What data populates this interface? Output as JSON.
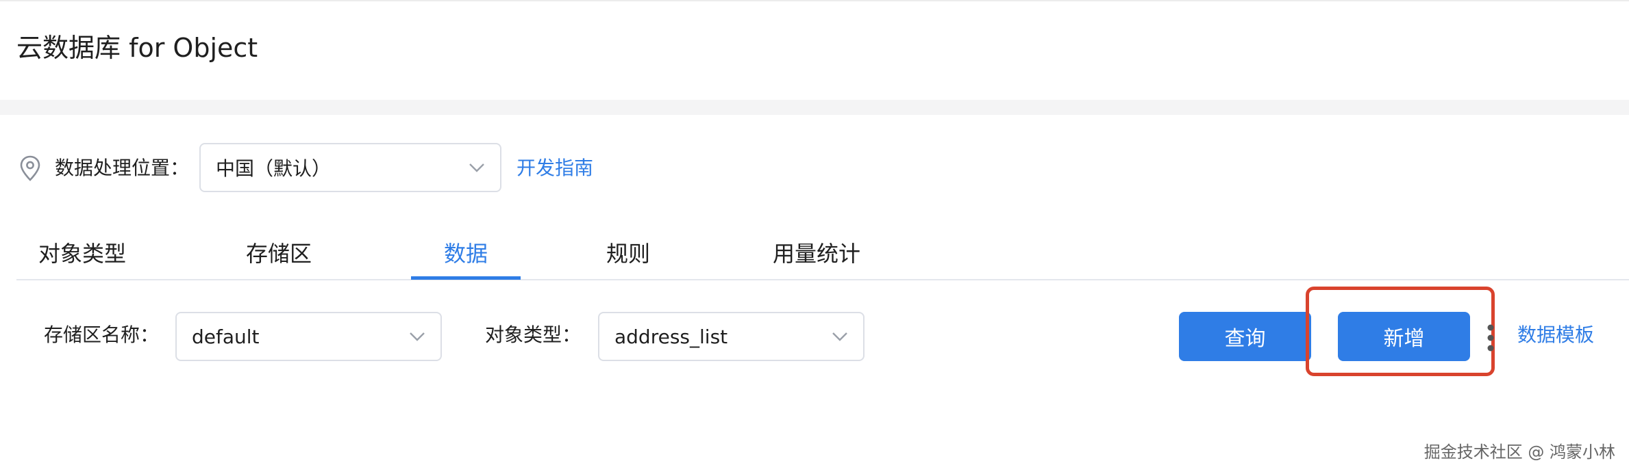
{
  "header": {
    "title": "云数据库 for Object"
  },
  "location": {
    "icon": "map-pin-icon",
    "label": "数据处理位置：",
    "selected": "中国（默认）",
    "guide_link": "开发指南"
  },
  "tabs": [
    {
      "label": "对象类型",
      "active": false
    },
    {
      "label": "存储区",
      "active": false
    },
    {
      "label": "数据",
      "active": true
    },
    {
      "label": "规则",
      "active": false
    },
    {
      "label": "用量统计",
      "active": false
    }
  ],
  "filters": {
    "bucket_label": "存储区名称：",
    "bucket_value": "default",
    "type_label": "对象类型：",
    "type_value": "address_list"
  },
  "actions": {
    "query_label": "查询",
    "add_label": "新增",
    "template_label": "数据模板"
  },
  "watermark": "掘金技术社区 @ 鸿蒙小林",
  "colors": {
    "accent": "#2f7de6",
    "highlight_border": "#d9432d",
    "band": "#f4f4f5",
    "border": "#dcdfe6"
  }
}
